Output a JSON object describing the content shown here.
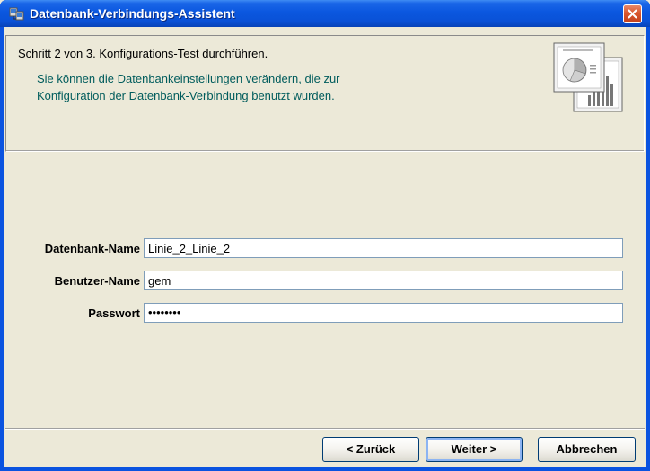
{
  "window": {
    "title": "Datenbank-Verbindungs-Assistent"
  },
  "header": {
    "step": "Schritt 2 von 3. Konfigurations-Test durchführen.",
    "description_line1": "Sie können die Datenbankeinstellungen verändern, die zur",
    "description_line2": "Konfiguration der Datenbank-Verbindung benutzt wurden."
  },
  "form": {
    "db_name_label": "Datenbank-Name",
    "db_name_value": "Linie_2_Linie_2",
    "user_name_label": "Benutzer-Name",
    "user_name_value": "gem",
    "password_label": "Passwort",
    "password_value": "••••••••"
  },
  "buttons": {
    "back": "< Zurück",
    "next": "Weiter >",
    "cancel": "Abbrechen"
  },
  "colors": {
    "title_bar": "#0a53e0",
    "description_text": "#005c5c",
    "dialog_bg": "#ece9d8"
  },
  "icons": {
    "title": "database-connection-icon",
    "close": "close-icon",
    "header_graphic": "chart-report-icon"
  }
}
